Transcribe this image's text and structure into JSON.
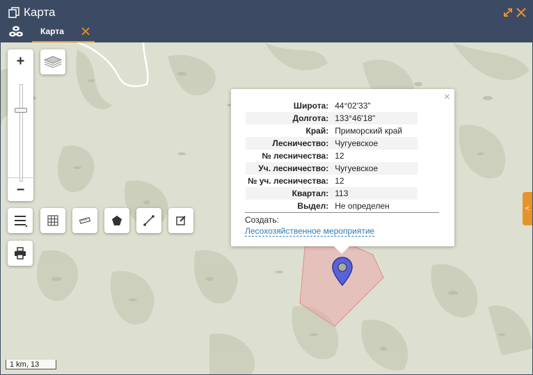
{
  "window": {
    "title": "Карта",
    "icon": "copy-icon",
    "controls": [
      "maximize-icon",
      "close-icon"
    ],
    "accent_color": "#e8922a",
    "header_color": "#3d4a63"
  },
  "tabs": [
    {
      "label": "Карта",
      "active": true
    }
  ],
  "map": {
    "zoom_in_label": "+",
    "zoom_out_label": "−",
    "tools": [
      "layers-icon",
      "menu-icon",
      "grid-icon",
      "ruler-icon",
      "polygon-icon",
      "line-icon",
      "edit-icon",
      "print-icon"
    ],
    "side_toggle_label": "<",
    "scale_label": "1 km, 13"
  },
  "popup": {
    "rows": [
      {
        "key": "Широта:",
        "value": "44°02'33\""
      },
      {
        "key": "Долгота:",
        "value": "133°46'18\""
      },
      {
        "key": "Край:",
        "value": "Приморский край"
      },
      {
        "key": "Лесничество:",
        "value": "Чугуевское"
      },
      {
        "key": "№ лесничества:",
        "value": "12"
      },
      {
        "key": "Уч. лесничество:",
        "value": "Чугуевское"
      },
      {
        "key": "№ уч. лесничества:",
        "value": "12"
      },
      {
        "key": "Квартал:",
        "value": "113"
      },
      {
        "key": "Выдел:",
        "value": "Не определен"
      }
    ],
    "create_label": "Создать:",
    "link_label": "Лесохозяйственное мероприятие",
    "close_label": "×"
  }
}
